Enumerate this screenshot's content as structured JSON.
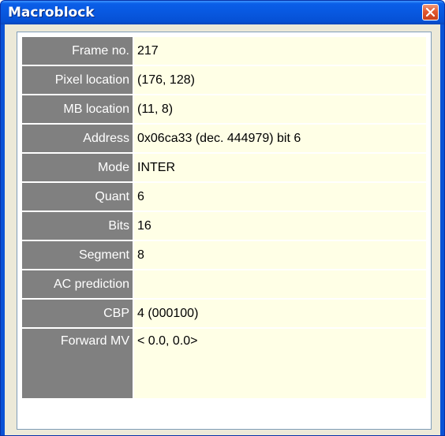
{
  "window": {
    "title": "Macroblock"
  },
  "rows": [
    {
      "label": "Frame no.",
      "value": "217"
    },
    {
      "label": "Pixel location",
      "value": "(176, 128)"
    },
    {
      "label": "MB location",
      "value": "(11, 8)"
    },
    {
      "label": "Address",
      "value": "0x06ca33 (dec. 444979) bit 6"
    },
    {
      "label": "Mode",
      "value": "INTER"
    },
    {
      "label": "Quant",
      "value": "6"
    },
    {
      "label": "Bits",
      "value": "16"
    },
    {
      "label": "Segment",
      "value": "8"
    },
    {
      "label": "AC prediction",
      "value": ""
    },
    {
      "label": "CBP",
      "value": " 4 (000100)"
    },
    {
      "label": "Forward MV",
      "value": "< 0.0, 0.0>"
    }
  ]
}
